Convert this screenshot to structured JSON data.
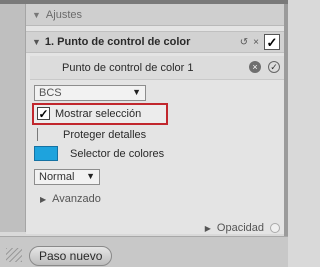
{
  "ajustes": {
    "label": "Ajustes"
  },
  "adjustment": {
    "title": "1. Punto de control de color",
    "sub_item_label": "Punto de control de color 1"
  },
  "controls": {
    "mode_select": "BCS",
    "mostrar_seleccion": {
      "label": "Mostrar selección",
      "checked": true
    },
    "proteger_detalles": {
      "label": "Proteger detalles",
      "checked": false
    },
    "selector_colores": {
      "label": "Selector de colores",
      "color": "#1ea3dd"
    },
    "blend_select": "Normal",
    "avanzado": "Avanzado"
  },
  "opacidad": {
    "label": "Opacidad"
  },
  "footer": {
    "button_label": "Paso nuevo"
  },
  "icons": {
    "collapse": "▼",
    "expand": "▶",
    "dropdown": "▼",
    "check": "✓",
    "close": "×",
    "link": "↺"
  },
  "colors": {
    "highlight": "#c1272d",
    "swatch": "#1ea3dd"
  }
}
